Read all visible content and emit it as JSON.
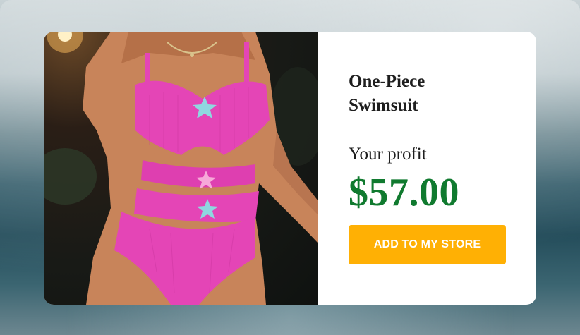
{
  "product": {
    "title": "One-Piece Swimsuit",
    "image_icon": "swimsuit-photo"
  },
  "profit": {
    "label": "Your profit",
    "amount": "$57.00"
  },
  "actions": {
    "add_label": "ADD TO MY STORE"
  },
  "colors": {
    "price": "#107a2f",
    "button": "#ffb004",
    "swimsuit": "#e445b6"
  }
}
